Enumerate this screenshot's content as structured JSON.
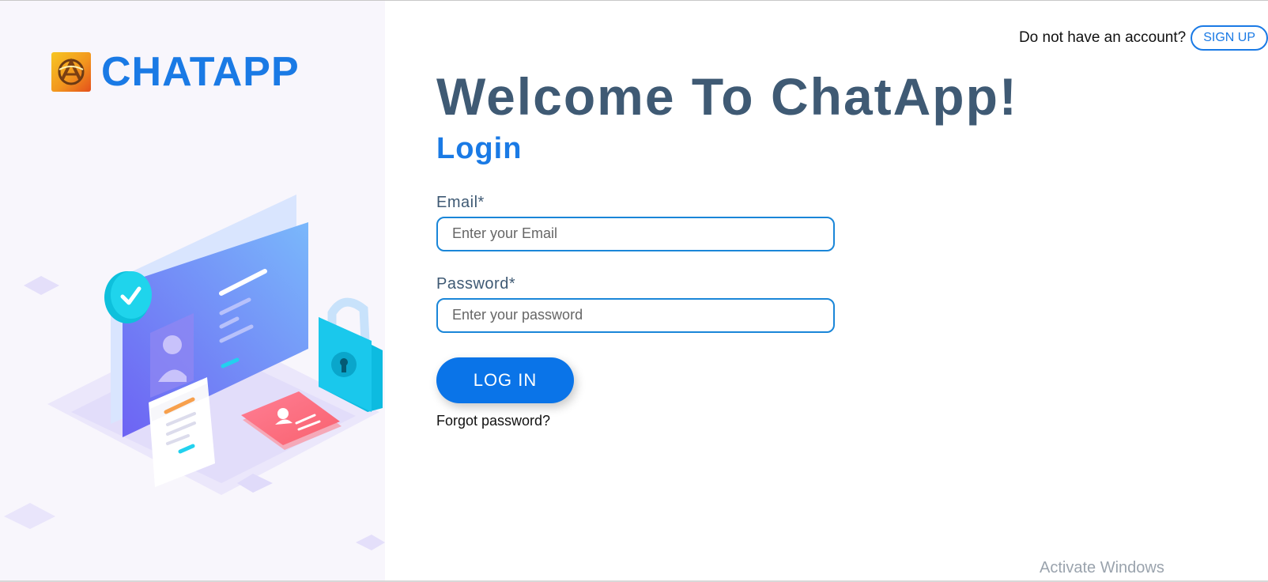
{
  "brand": {
    "name": "CHATAPP",
    "logo_icon": "chatapp-logo-icon"
  },
  "header": {
    "account_prompt": "Do not have an account?",
    "signup_label": "SIGN UP"
  },
  "main": {
    "welcome_heading": "Welcome To ChatApp!",
    "login_heading": "Login",
    "email_label": "Email*",
    "email_placeholder": "Enter your Email",
    "email_value": "",
    "password_label": "Password*",
    "password_placeholder": "Enter your password",
    "password_value": "",
    "login_button": "LOG IN",
    "forgot_password": "Forgot password?"
  },
  "system": {
    "watermark": "Activate Windows"
  },
  "colors": {
    "accent": "#1a7ae5",
    "heading": "#3f5a74",
    "button": "#0a74e8",
    "left_panel_bg": "#f8f6fc"
  }
}
